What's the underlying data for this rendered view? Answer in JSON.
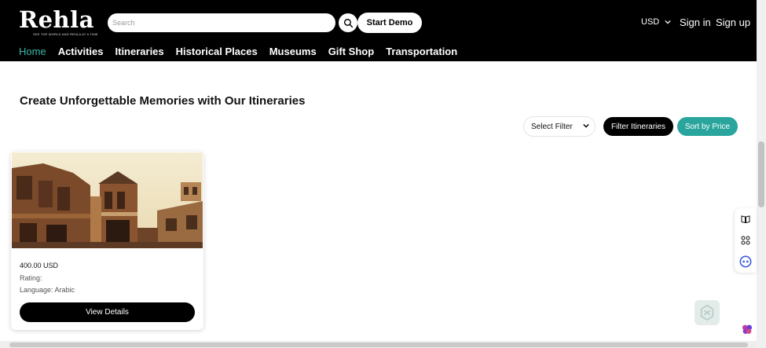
{
  "header": {
    "logo_text": "Rehla",
    "logo_tagline": "SEE THE WORLD AND REHLA AT A TIME",
    "search_placeholder": "Search",
    "start_demo_label": "Start Demo",
    "currency": "USD",
    "signin_label": "Sign in",
    "signup_label": "Sign up",
    "nav": [
      "Home",
      "Activities",
      "Itineraries",
      "Historical Places",
      "Museums",
      "Gift Shop",
      "Transportation"
    ],
    "active_nav": "Home"
  },
  "main": {
    "title": "Create Unforgettable Memories with Our Itineraries",
    "select_filter": "Select Filter",
    "filter_button": "Filter Itineraries",
    "sort_button": "Sort by Price"
  },
  "card": {
    "price": "400.00 USD",
    "rating": "Rating:",
    "language": "Language: Arabic",
    "view_button": "View Details"
  },
  "colors": {
    "header_bg": "#000000",
    "accent_teal": "#2aa59e",
    "active_nav": "#3bb7ab"
  },
  "icons": [
    "search-icon",
    "chevron-down-icon",
    "book-icon",
    "grid-icon",
    "chat-bot-icon",
    "brain-icon",
    "watermark-icon"
  ]
}
